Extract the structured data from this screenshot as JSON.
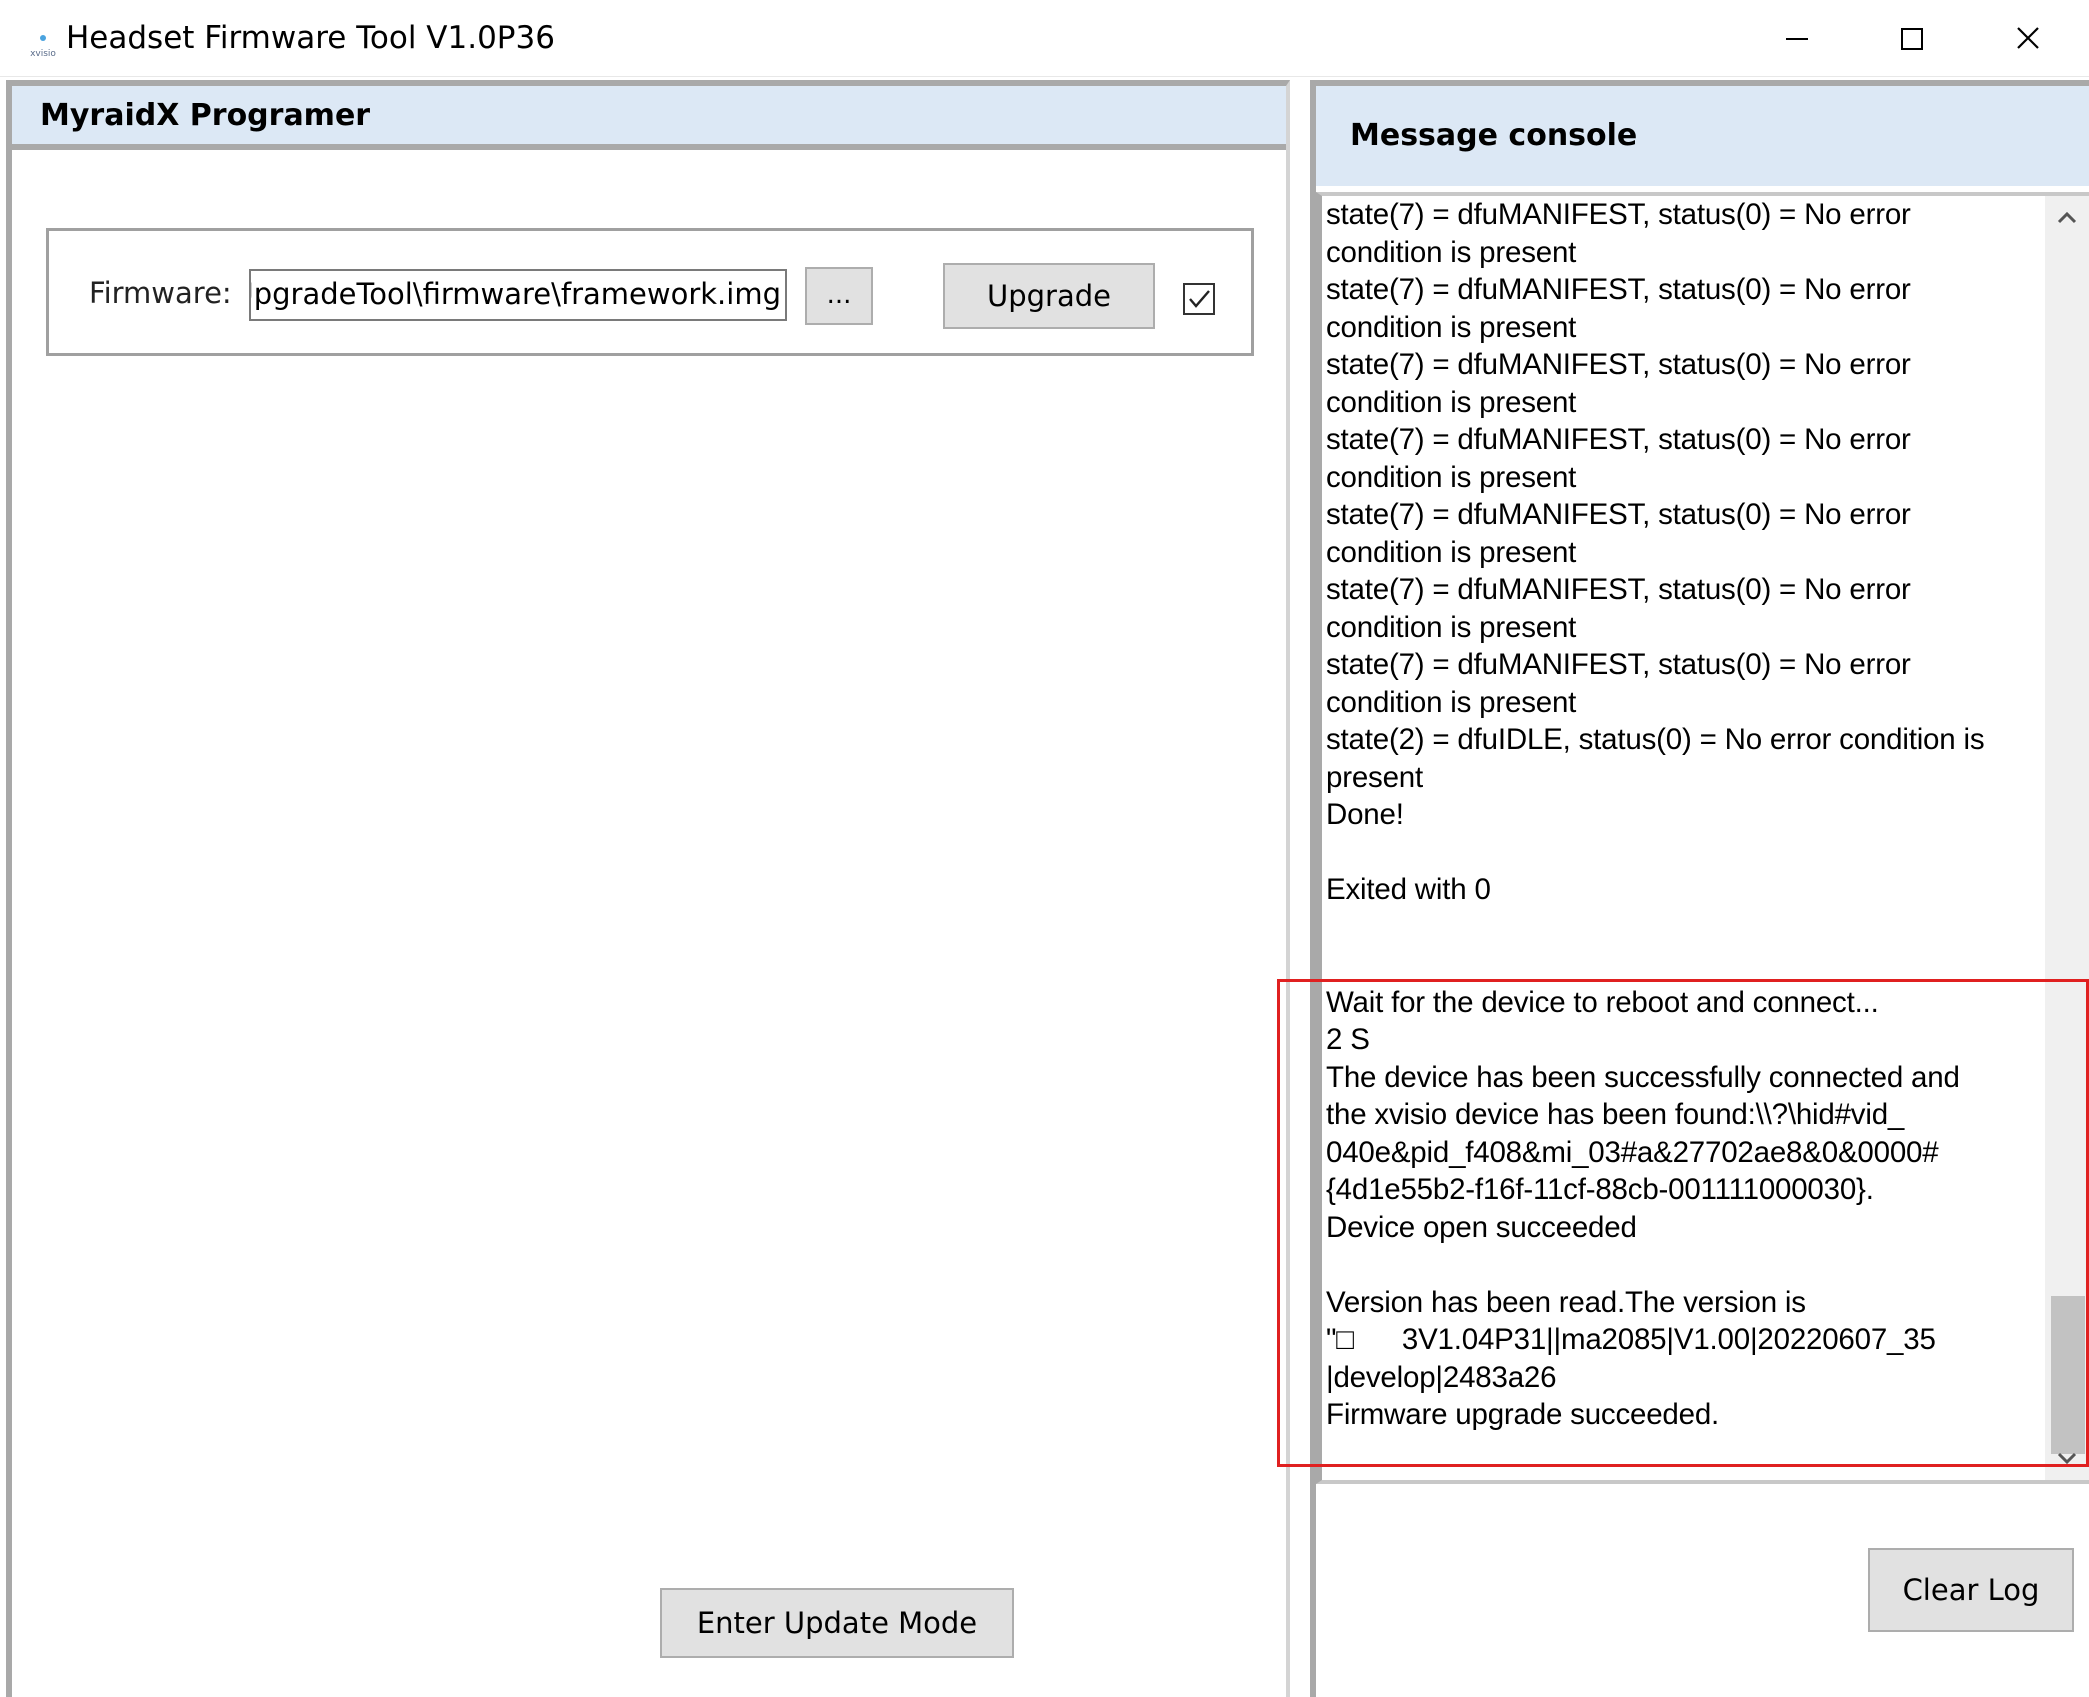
{
  "window": {
    "title": "Headset Firmware Tool V1.0P36",
    "icon": "xvisio-logo-icon",
    "icon_text": "xvisio"
  },
  "left_panel": {
    "title": "MyraidX Programer",
    "firmware_label": "Firmware:",
    "firmware_path": "ıUpgradeTool\\firmware\\framework.img",
    "browse_label": "...",
    "upgrade_label": "Upgrade",
    "checkbox_checked": true,
    "enter_update_label": "Enter Update Mode"
  },
  "right_panel": {
    "title": "Message console",
    "clear_label": "Clear Log",
    "log_lines": [
      "state(7) = dfuMANIFEST, status(0) = No error",
      "condition is present",
      "state(7) = dfuMANIFEST, status(0) = No error",
      "condition is present",
      "state(7) = dfuMANIFEST, status(0) = No error",
      "condition is present",
      "state(7) = dfuMANIFEST, status(0) = No error",
      "condition is present",
      "state(7) = dfuMANIFEST, status(0) = No error",
      "condition is present",
      "state(7) = dfuMANIFEST, status(0) = No error",
      "condition is present",
      "state(7) = dfuMANIFEST, status(0) = No error",
      "condition is present",
      "state(2) = dfuIDLE, status(0) = No error condition is",
      "present",
      "Done!",
      "",
      "Exited with 0",
      "",
      "",
      "Wait for the device to reboot and connect...",
      "2 S",
      "The device has been successfully connected and",
      "the xvisio device has been found:\\\\?\\hid#vid_",
      "040e&pid_f408&mi_03#a&27702ae8&0&0000#",
      "{4d1e55b2-f16f-11cf-88cb-001111000030}.",
      "Device open succeeded",
      "",
      "Version has been read.The version is",
      "\"□      3V1.04P31||ma2085|V1.00|20220607_35",
      "|develop|2483a26",
      "Firmware upgrade succeeded."
    ]
  },
  "colors": {
    "header_bg": "#dce8f5",
    "highlight": "#e02020"
  }
}
